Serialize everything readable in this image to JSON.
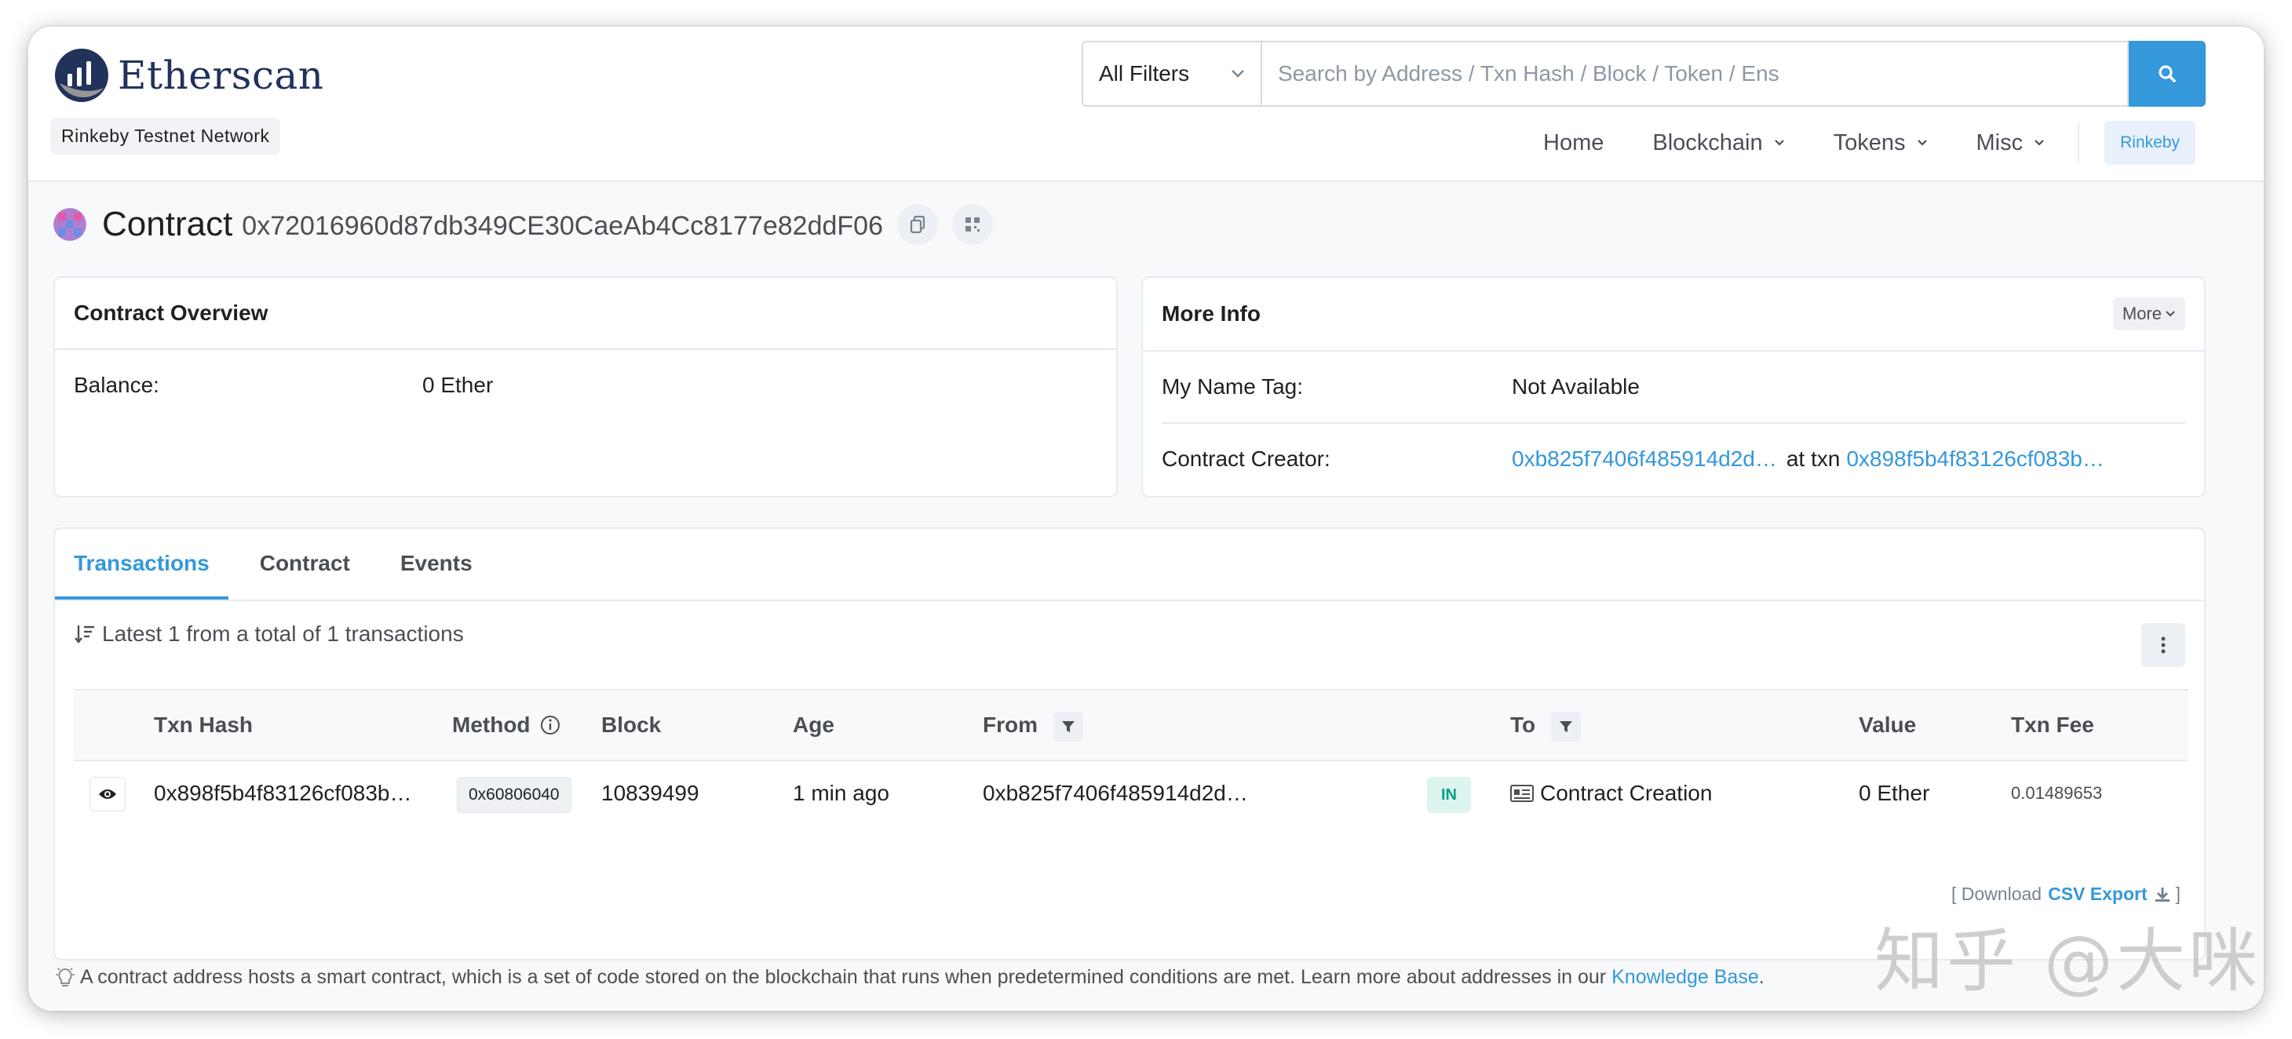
{
  "header": {
    "logo_text": "Etherscan",
    "network": "Rinkeby Testnet Network",
    "filter_label": "All Filters",
    "search_placeholder": "Search by Address / Txn Hash / Block / Token / Ens",
    "nav": [
      {
        "label": "Home"
      },
      {
        "label": "Blockchain"
      },
      {
        "label": "Tokens"
      },
      {
        "label": "Misc"
      }
    ],
    "network_button": "Rinkeby"
  },
  "page": {
    "title": "Contract",
    "address": "0x72016960d87db349CE30CaeAb4Cc8177e82ddF06"
  },
  "overview": {
    "title": "Contract Overview",
    "balance_label": "Balance:",
    "balance_value": "0 Ether"
  },
  "more_info": {
    "title": "More Info",
    "more_button": "More",
    "name_tag_label": "My Name Tag:",
    "name_tag_value": "Not Available",
    "creator_label": "Contract Creator:",
    "creator_address": "0xb825f7406f485914d2d…",
    "at_txn": "at txn",
    "creator_txn": "0x898f5b4f83126cf083b…"
  },
  "tabs": [
    "Transactions",
    "Contract",
    "Events"
  ],
  "transactions": {
    "summary": "Latest 1 from a total of 1 transactions",
    "columns": {
      "txn_hash": "Txn Hash",
      "method": "Method",
      "block": "Block",
      "age": "Age",
      "from": "From",
      "to": "To",
      "value": "Value",
      "txn_fee": "Txn Fee"
    },
    "rows": [
      {
        "txn_hash": "0x898f5b4f83126cf083b…",
        "method": "0x60806040",
        "block": "10839499",
        "age": "1 min ago",
        "from": "0xb825f7406f485914d2d…",
        "direction": "IN",
        "to": "Contract Creation",
        "value": "0 Ether",
        "txn_fee": "0.01489653"
      }
    ],
    "download_prefix": "[ Download",
    "download_link": "CSV Export",
    "download_suffix": "]"
  },
  "footer_note": {
    "text": "A contract address hosts a smart contract, which is a set of code stored on the blockchain that runs when predetermined conditions are met. Learn more about addresses in our",
    "link": "Knowledge Base",
    "end": "."
  },
  "watermark": "知乎 @大咪",
  "colors": {
    "accent": "#3498db",
    "brand_dark": "#21325b",
    "success": "#00a186",
    "background": "#f8f9fa"
  }
}
